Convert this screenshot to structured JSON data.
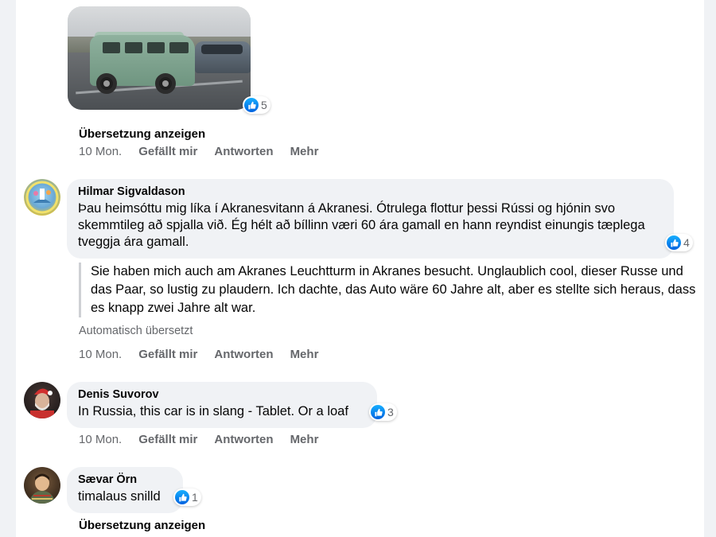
{
  "comment_top": {
    "reaction_count": "5",
    "see_translation": "Übersetzung anzeigen",
    "time": "10 Mon.",
    "like": "Gefällt mir",
    "reply": "Antworten",
    "more": "Mehr"
  },
  "comment_hilmar": {
    "author": "Hilmar Sigvaldason",
    "text": "Þau heimsóttu mig líka í Akranesvitann á Akranesi. Ótrulega flottur þessi Rússi og hjónin svo skemmtileg að spjalla við. Ég hélt að bíllinn væri 60 ára gamall en hann reyndist einungis tæplega tveggja ára gamall.",
    "reaction_count": "4",
    "translation": "Sie haben mich auch am Akranes Leuchtturm in Akranes besucht. Unglaublich cool, dieser Russe und das Paar, so lustig zu plaudern. Ich dachte, das Auto wäre 60 Jahre alt, aber es stellte sich heraus, dass es knapp zwei Jahre alt war.",
    "auto_translated": "Automatisch übersetzt",
    "time": "10 Mon.",
    "like": "Gefällt mir",
    "reply": "Antworten",
    "more": "Mehr"
  },
  "comment_denis": {
    "author": "Denis Suvorov",
    "text": "In Russia, this car is in slang - Tablet. Or a loaf",
    "reaction_count": "3",
    "time": "10 Mon.",
    "like": "Gefällt mir",
    "reply": "Antworten",
    "more": "Mehr"
  },
  "comment_saevar": {
    "author": "Sævar Örn",
    "text": "timalaus snilld",
    "reaction_count": "1",
    "see_translation": "Übersetzung anzeigen"
  },
  "icons": {
    "reaction": "like-icon"
  },
  "colors": {
    "like_blue": "#1877f2",
    "bubble_bg": "#f0f2f5",
    "secondary_text": "#65676b"
  }
}
